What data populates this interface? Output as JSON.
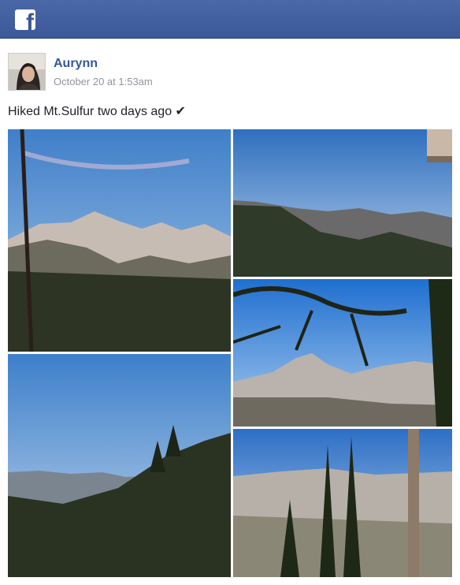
{
  "header": {
    "logo_icon": "facebook-logo-icon",
    "logo_glyph": "f",
    "brand_color": "#3b5998"
  },
  "post": {
    "author_name": "Aurynn",
    "timestamp": "October 20 at 1:53am",
    "text": "Hiked Mt.Sulfur two days ago ✔"
  },
  "photos": [
    {
      "name": "photo-gondola-cable-mountain"
    },
    {
      "name": "photo-valley-view"
    },
    {
      "name": "photo-pine-branch-mountain"
    },
    {
      "name": "photo-forest-ridge"
    },
    {
      "name": "photo-pine-trees-town"
    }
  ]
}
